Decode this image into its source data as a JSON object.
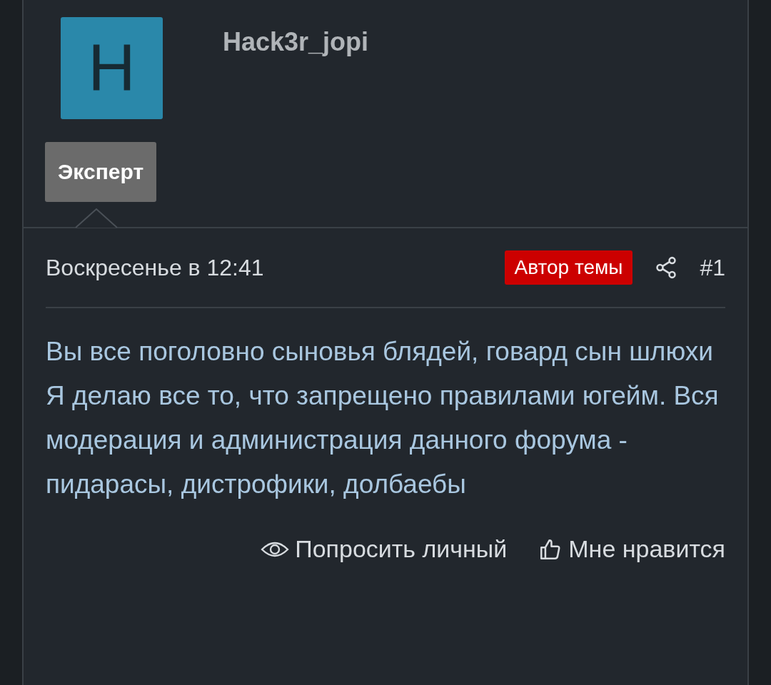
{
  "author": {
    "avatar_letter": "H",
    "name": "Hack3r_jopi",
    "rank": "Эксперт"
  },
  "post": {
    "date": "Воскресенье в 12:41",
    "author_badge": "Автор темы",
    "number": "#1",
    "body": "Вы все поголовно сыновья блядей, говард сын шлюхи\nЯ делаю все то, что запрещено правилами югейм. Вся модерация и администрация данного форума - пидарасы, дистрофики, долбаебы"
  },
  "actions": [
    {
      "kind": "watch",
      "label": "Попросить личный"
    },
    {
      "kind": "like",
      "label": "Мне нравится"
    }
  ]
}
